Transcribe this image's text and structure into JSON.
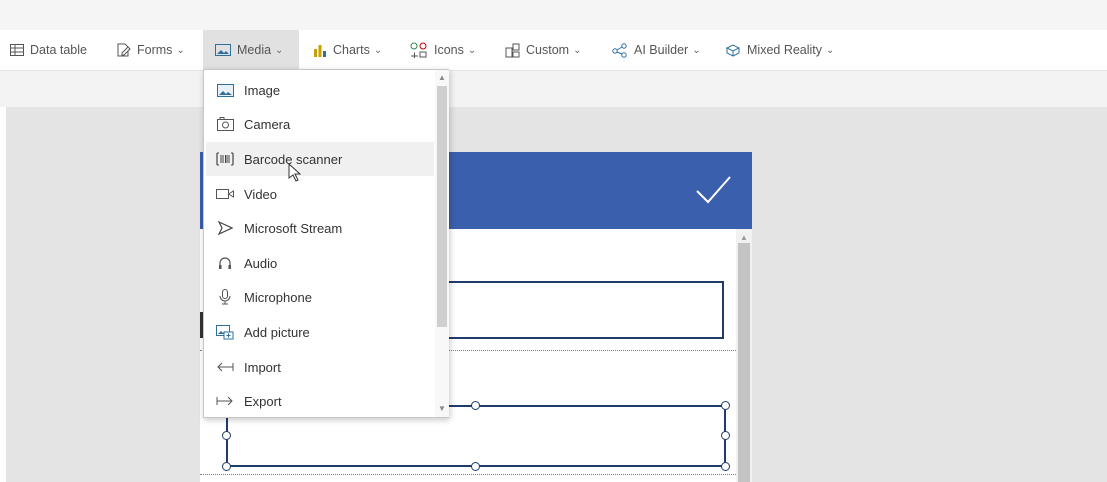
{
  "ribbon": {
    "items": [
      {
        "label": "Data table",
        "icon": "table-icon",
        "chevron": false
      },
      {
        "label": "Forms",
        "icon": "form-icon",
        "chevron": true
      },
      {
        "label": "Media",
        "icon": "image-icon",
        "chevron": true,
        "active": true
      },
      {
        "label": "Charts",
        "icon": "bar-chart-icon",
        "chevron": true
      },
      {
        "label": "Icons",
        "icon": "shapes-icon",
        "chevron": true
      },
      {
        "label": "Custom",
        "icon": "custom-component-icon",
        "chevron": true
      },
      {
        "label": "AI Builder",
        "icon": "ai-builder-icon",
        "chevron": true
      },
      {
        "label": "Mixed Reality",
        "icon": "mixed-reality-icon",
        "chevron": true
      }
    ]
  },
  "media_menu": {
    "items": [
      {
        "label": "Image",
        "icon": "image-icon"
      },
      {
        "label": "Camera",
        "icon": "camera-icon"
      },
      {
        "label": "Barcode scanner",
        "icon": "barcode-icon",
        "hovered": true
      },
      {
        "label": "Video",
        "icon": "video-icon"
      },
      {
        "label": "Microsoft Stream",
        "icon": "stream-icon"
      },
      {
        "label": "Audio",
        "icon": "headphones-icon"
      },
      {
        "label": "Microphone",
        "icon": "microphone-icon"
      },
      {
        "label": "Add picture",
        "icon": "add-picture-icon"
      },
      {
        "label": "Import",
        "icon": "import-icon"
      },
      {
        "label": "Export",
        "icon": "export-icon"
      }
    ]
  },
  "colors": {
    "header_blue": "#3a5fad",
    "field_border": "#1f3b6b",
    "canvas_gray": "#e4e4e4"
  }
}
